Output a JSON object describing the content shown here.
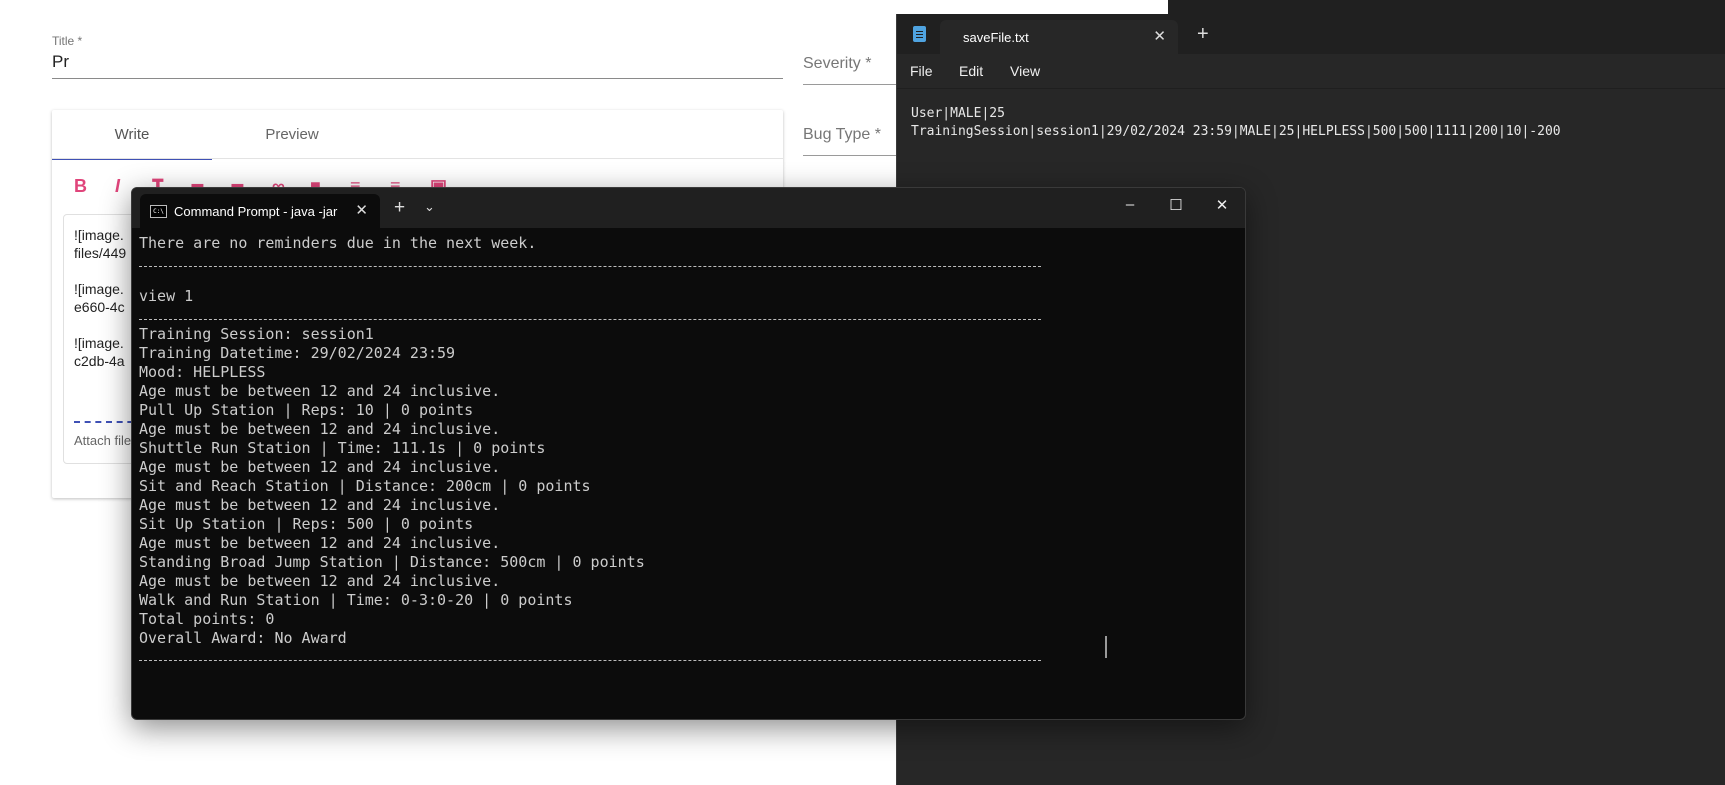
{
  "form": {
    "title_label": "Title *",
    "title_value": "Pr",
    "severity_label": "Severity *",
    "bug_type_label": "Bug Type *",
    "tabs": {
      "write": "Write",
      "preview": "Preview"
    },
    "toolbar": {
      "bold": "B",
      "italic": "I"
    },
    "editor_lines": [
      "![image.",
      "files/449",
      "![image.",
      "e660-4c",
      "![image.",
      "c2db-4a"
    ],
    "attach_text": "Attach file"
  },
  "notepad": {
    "tab_title": "saveFile.txt",
    "menu": [
      "File",
      "Edit",
      "View"
    ],
    "lines": [
      "User|MALE|25",
      "TrainingSession|session1|29/02/2024 23:59|MALE|25|HELPLESS|500|500|1111|200|10|-200"
    ]
  },
  "cmd": {
    "tab_title": "Command Prompt - java  -jar",
    "icon_text": "C:\\",
    "lines": {
      "reminders": "There are no reminders due in the next week.",
      "command": "view 1",
      "output": [
        "Training Session: session1",
        "Training Datetime: 29/02/2024 23:59",
        "Mood: HELPLESS",
        "Age must be between 12 and 24 inclusive.",
        "Pull Up Station | Reps: 10 | 0 points",
        "Age must be between 12 and 24 inclusive.",
        "Shuttle Run Station | Time: 111.1s | 0 points",
        "Age must be between 12 and 24 inclusive.",
        "Sit and Reach Station | Distance: 200cm | 0 points",
        "Age must be between 12 and 24 inclusive.",
        "Sit Up Station | Reps: 500 | 0 points",
        "Age must be between 12 and 24 inclusive.",
        "Standing Broad Jump Station | Distance: 500cm | 0 points",
        "Age must be between 12 and 24 inclusive.",
        "Walk and Run Station | Time: 0-3:0-20 | 0 points",
        "Total points: 0",
        "Overall Award: No Award"
      ]
    }
  }
}
